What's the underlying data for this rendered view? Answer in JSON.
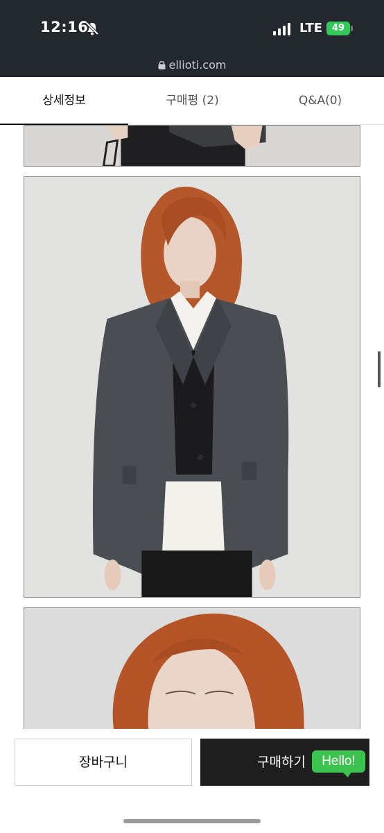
{
  "status_bar": {
    "time": "12:16",
    "network": "LTE",
    "battery": "49"
  },
  "browser": {
    "url": "ellioti.com"
  },
  "tabs": [
    {
      "label": "상세정보",
      "active": true
    },
    {
      "label": "구매평 (2)",
      "active": false
    },
    {
      "label": "Q&A(0)",
      "active": false
    }
  ],
  "actions": {
    "cart_label": "장바구니",
    "buy_label": "구매하기",
    "chat_badge": "Hello!"
  },
  "colors": {
    "top_bar": "#23272e",
    "battery": "#34c759",
    "buy_button": "#1e1e1e",
    "chat_badge": "#3cc24f"
  }
}
